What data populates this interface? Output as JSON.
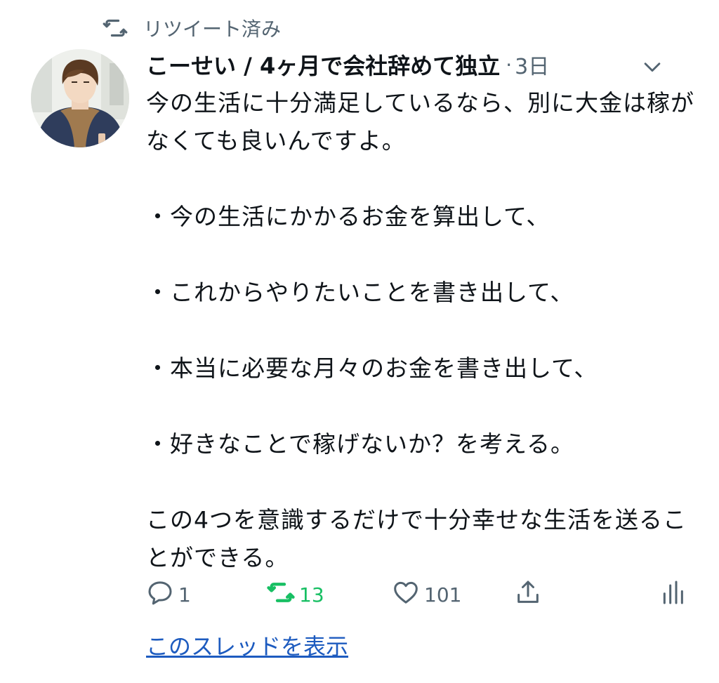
{
  "retweet": {
    "label": "リツイート済み",
    "icon": "retweet-icon"
  },
  "tweet": {
    "author": "こーせい / 4ヶ月で会社辞めて独立",
    "separator": "·",
    "time": "3日",
    "text": "今の生活に十分満足しているなら、別に大金は稼がなくても良いんですよ。\n\n・今の生活にかかるお金を算出して、\n\n・これからやりたいことを書き出して、\n\n・本当に必要な月々のお金を書き出して、\n\n・好きなことで稼げないか？を考える。\n\nこの4つを意識するだけで十分幸せな生活を送ることができる。",
    "actions": {
      "reply_count": "1",
      "retweet_count": "13",
      "like_count": "101"
    },
    "show_thread": "このスレッドを表示"
  },
  "colors": {
    "text": "#0f1419",
    "muted": "#536471",
    "retweet_active": "#17bf63",
    "link": "#1d5bbf"
  }
}
